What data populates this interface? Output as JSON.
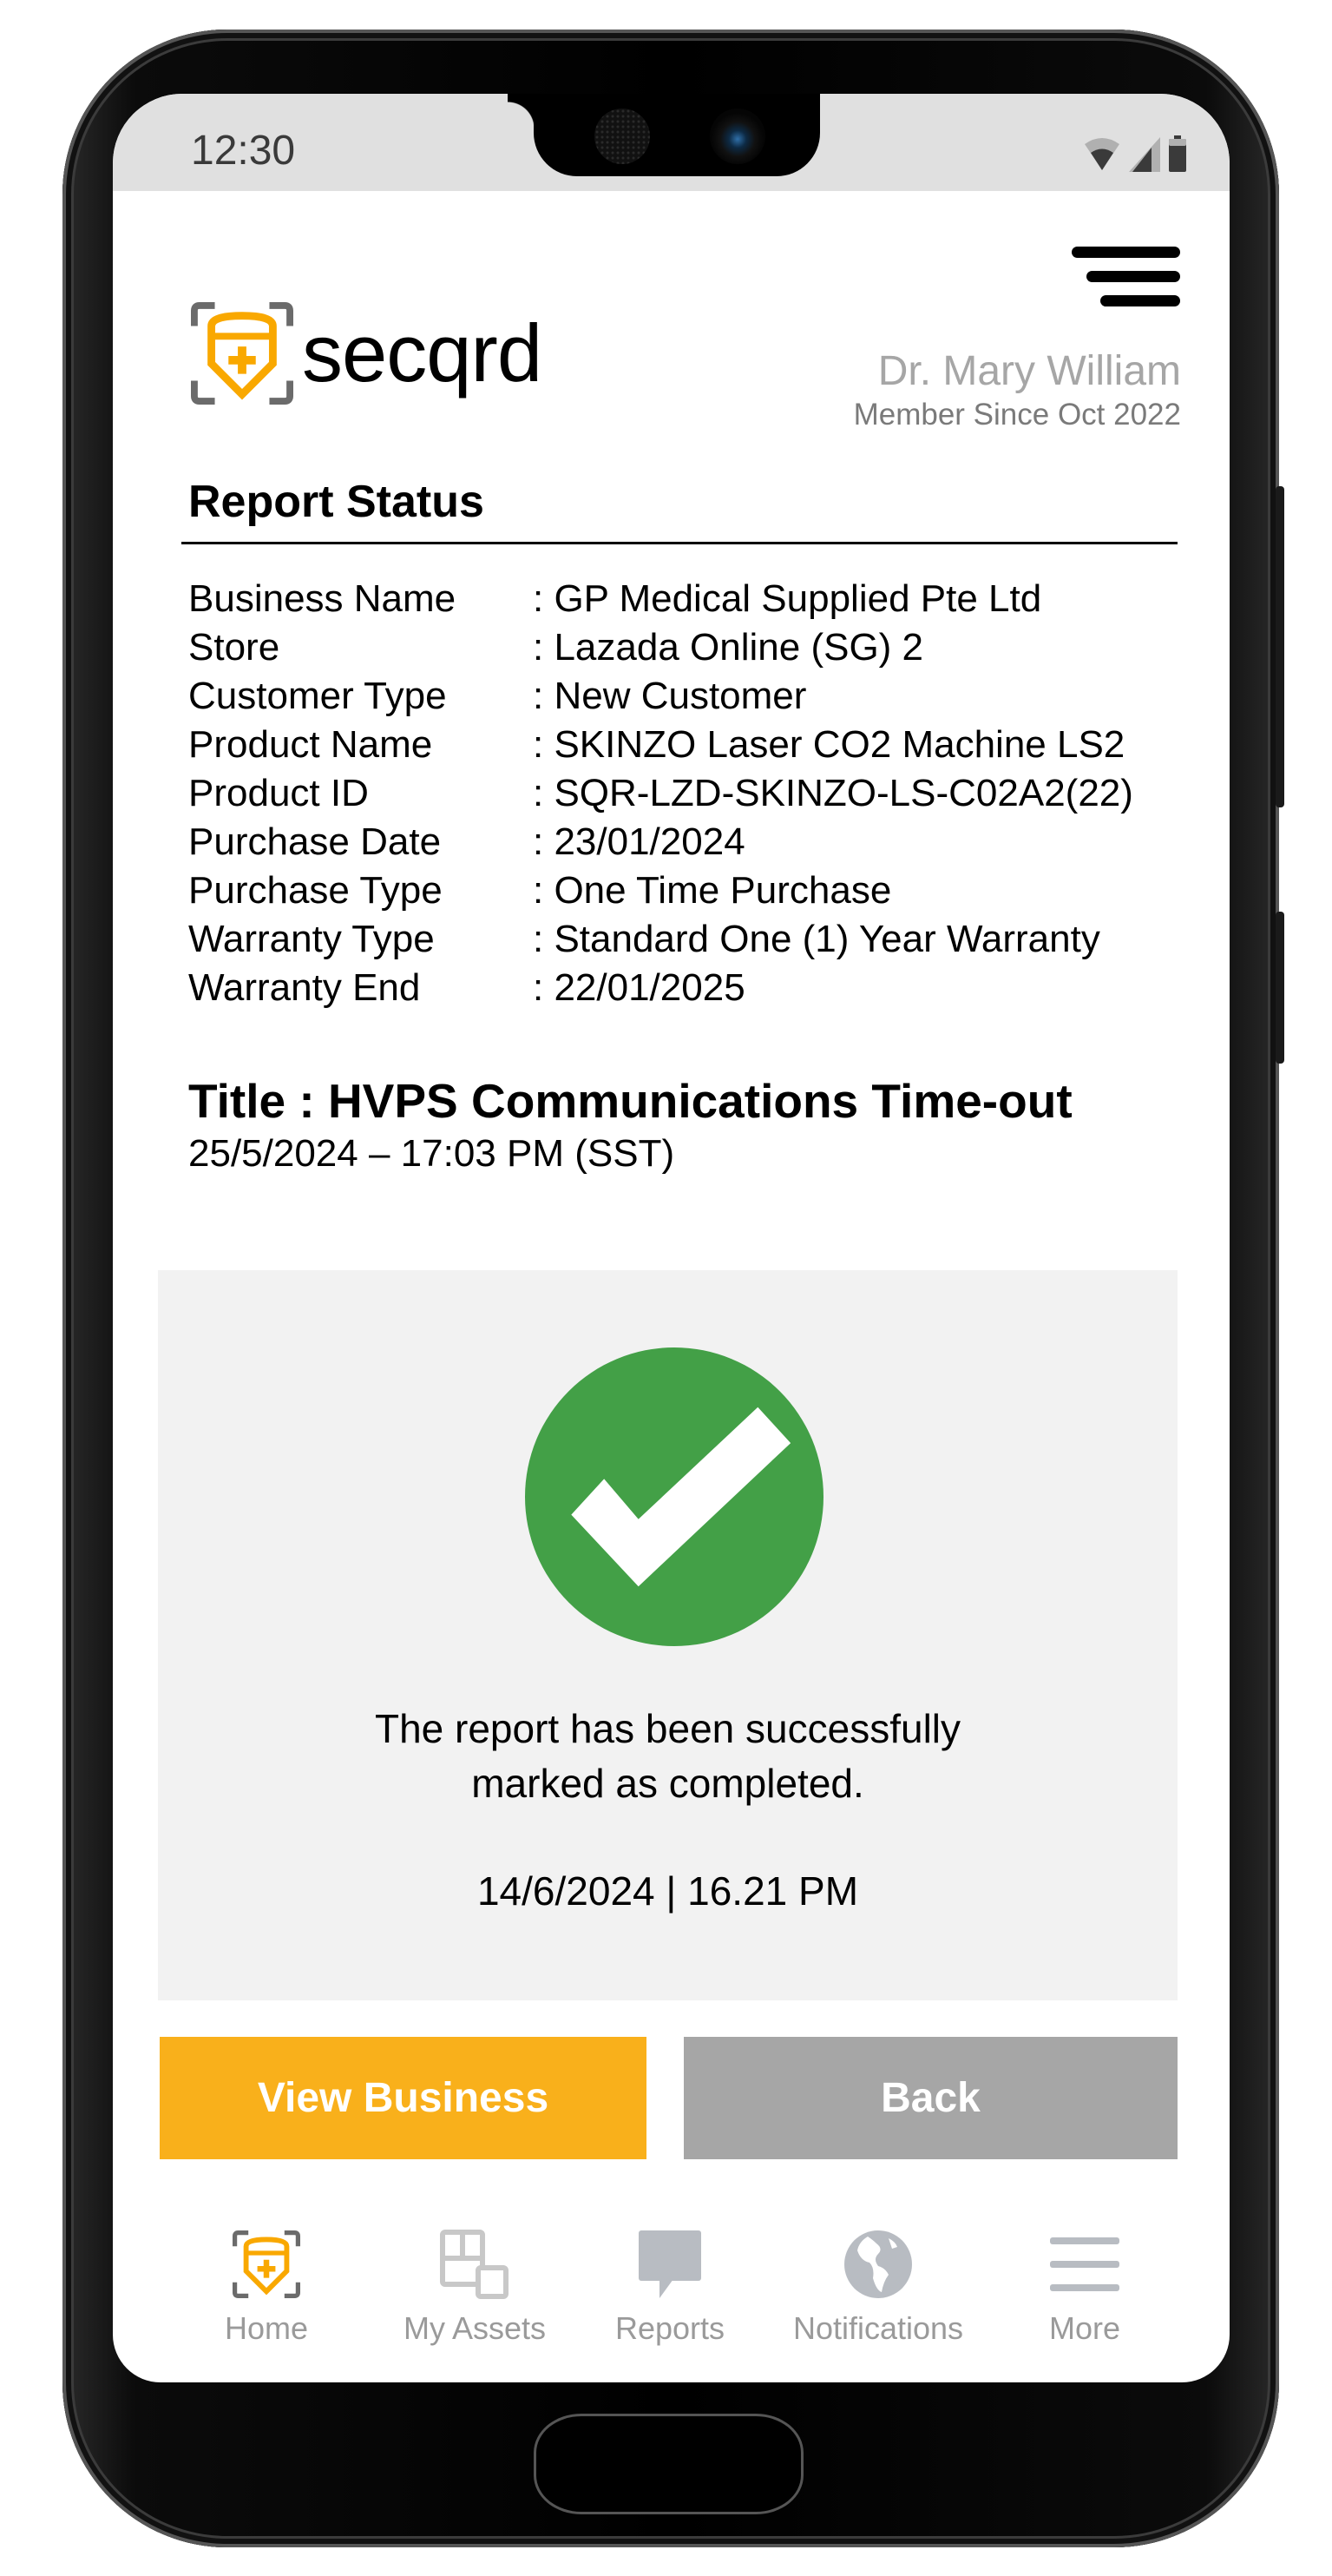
{
  "status_bar": {
    "time": "12:30",
    "icons": [
      "wifi-icon",
      "signal-icon",
      "battery-icon"
    ]
  },
  "header": {
    "brand": "secqrd",
    "user_name": "Dr. Mary William",
    "member_since": "Member Since Oct 2022",
    "menu_icon": "hamburger-menu-icon"
  },
  "report": {
    "section_title": "Report Status",
    "details": [
      {
        "label": "Business Name",
        "value": ": GP Medical Supplied Pte Ltd"
      },
      {
        "label": "Store",
        "value": ": Lazada Online (SG) 2"
      },
      {
        "label": "Customer Type",
        "value": ": New Customer"
      },
      {
        "label": "Product Name",
        "value": ": SKINZO Laser CO2 Machine LS2"
      },
      {
        "label": "Product ID",
        "value": ": SQR-LZD-SKINZO-LS-C02A2(22)"
      },
      {
        "label": "Purchase Date",
        "value": ": 23/01/2024"
      },
      {
        "label": "Purchase Type",
        "value": ": One Time Purchase"
      },
      {
        "label": "Warranty Type",
        "value": ": Standard One (1) Year Warranty"
      },
      {
        "label": "Warranty End",
        "value": ": 22/01/2025"
      }
    ],
    "title": "Title : HVPS Communications Time-out",
    "reported_at": "25/5/2024 – 17:03 PM (SST)"
  },
  "success": {
    "icon": "check-circle-icon",
    "message_line1": "The report has been successfully",
    "message_line2": "marked as completed.",
    "timestamp": "14/6/2024 | 16.21 PM"
  },
  "actions": {
    "view_business": "View Business",
    "back": "Back"
  },
  "bottom_nav": [
    {
      "label": "Home",
      "icon": "shield-plus-icon",
      "active": true
    },
    {
      "label": "My Assets",
      "icon": "assets-grid-icon",
      "active": false
    },
    {
      "label": "Reports",
      "icon": "chat-bubble-icon",
      "active": false
    },
    {
      "label": "Notifications",
      "icon": "globe-icon",
      "active": false
    },
    {
      "label": "More",
      "icon": "menu-lines-icon",
      "active": false
    }
  ],
  "colors": {
    "accent": "#f9b01b",
    "success": "#43a047",
    "secondary_button": "#a6a6a6",
    "card_bg": "#f2f2f2",
    "nav_inactive": "#b8bcc2"
  }
}
